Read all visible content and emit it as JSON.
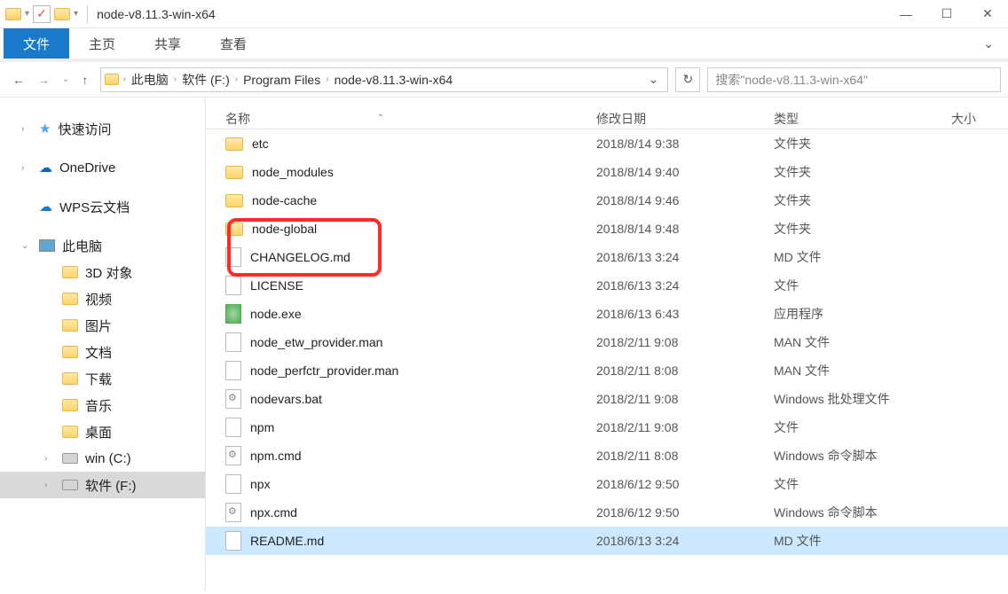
{
  "window": {
    "title": "node-v8.11.3-win-x64"
  },
  "ribbon": {
    "file": "文件",
    "home": "主页",
    "share": "共享",
    "view": "查看"
  },
  "breadcrumb": {
    "items": [
      "此电脑",
      "软件 (F:)",
      "Program Files",
      "node-v8.11.3-win-x64"
    ]
  },
  "search": {
    "placeholder": "搜索\"node-v8.11.3-win-x64\""
  },
  "sidebar": {
    "quick_access": "快速访问",
    "onedrive": "OneDrive",
    "wps": "WPS云文档",
    "this_pc": "此电脑",
    "items": [
      {
        "label": "3D 对象"
      },
      {
        "label": "视频"
      },
      {
        "label": "图片"
      },
      {
        "label": "文档"
      },
      {
        "label": "下载"
      },
      {
        "label": "音乐"
      },
      {
        "label": "桌面"
      },
      {
        "label": "win (C:)"
      },
      {
        "label": "软件 (F:)"
      }
    ]
  },
  "columns": {
    "name": "名称",
    "modified": "修改日期",
    "type": "类型",
    "size": "大小"
  },
  "files": [
    {
      "icon": "folder",
      "name": "etc",
      "date": "2018/8/14 9:38",
      "type": "文件夹"
    },
    {
      "icon": "folder",
      "name": "node_modules",
      "date": "2018/8/14 9:40",
      "type": "文件夹"
    },
    {
      "icon": "folder",
      "name": "node-cache",
      "date": "2018/8/14 9:46",
      "type": "文件夹"
    },
    {
      "icon": "folder",
      "name": "node-global",
      "date": "2018/8/14 9:48",
      "type": "文件夹"
    },
    {
      "icon": "file",
      "name": "CHANGELOG.md",
      "date": "2018/6/13 3:24",
      "type": "MD 文件"
    },
    {
      "icon": "file",
      "name": "LICENSE",
      "date": "2018/6/13 3:24",
      "type": "文件"
    },
    {
      "icon": "exe",
      "name": "node.exe",
      "date": "2018/6/13 6:43",
      "type": "应用程序"
    },
    {
      "icon": "file",
      "name": "node_etw_provider.man",
      "date": "2018/2/11 9:08",
      "type": "MAN 文件"
    },
    {
      "icon": "file",
      "name": "node_perfctr_provider.man",
      "date": "2018/2/11 8:08",
      "type": "MAN 文件"
    },
    {
      "icon": "bat",
      "name": "nodevars.bat",
      "date": "2018/2/11 9:08",
      "type": "Windows 批处理文件"
    },
    {
      "icon": "file",
      "name": "npm",
      "date": "2018/2/11 9:08",
      "type": "文件"
    },
    {
      "icon": "cmd",
      "name": "npm.cmd",
      "date": "2018/2/11 8:08",
      "type": "Windows 命令脚本"
    },
    {
      "icon": "file",
      "name": "npx",
      "date": "2018/6/12 9:50",
      "type": "文件"
    },
    {
      "icon": "cmd",
      "name": "npx.cmd",
      "date": "2018/6/12 9:50",
      "type": "Windows 命令脚本"
    },
    {
      "icon": "file",
      "name": "README.md",
      "date": "2018/6/13 3:24",
      "type": "MD 文件",
      "selected": true
    }
  ]
}
